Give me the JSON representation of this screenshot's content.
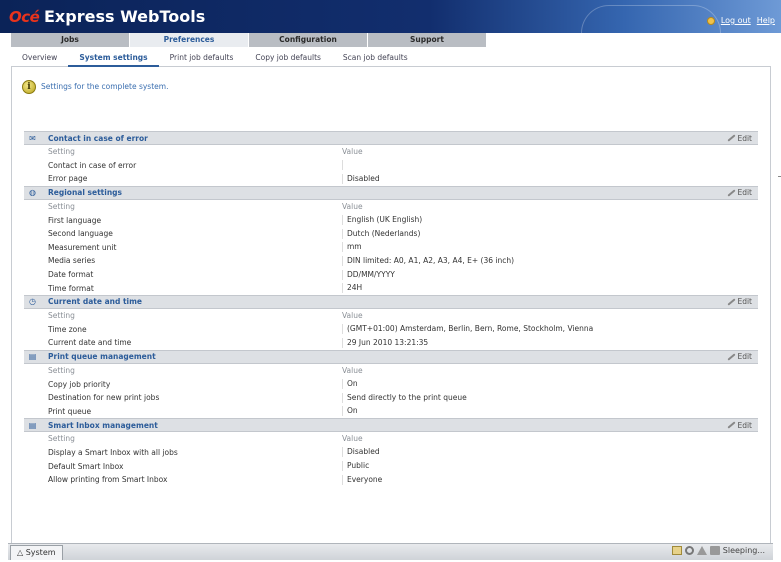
{
  "header": {
    "logo": "Océ",
    "title": "Express WebTools",
    "logout": "Log out",
    "help": "Help"
  },
  "main_tabs": [
    "Jobs",
    "Preferences",
    "Configuration",
    "Support"
  ],
  "subtabs": [
    "Overview",
    "System settings",
    "Print job defaults",
    "Copy job defaults",
    "Scan job defaults"
  ],
  "info": "Settings for the complete system.",
  "edit_label": "Edit",
  "col_setting": "Setting",
  "col_value": "Value",
  "sections": [
    {
      "title": "Contact in case of error",
      "icon": "envelope-icon",
      "rows": [
        {
          "k": "Contact in case of error",
          "v": ""
        },
        {
          "k": "Error page",
          "v": "Disabled"
        }
      ]
    },
    {
      "title": "Regional settings",
      "icon": "globe-icon",
      "rows": [
        {
          "k": "First language",
          "v": "English (UK English)"
        },
        {
          "k": "Second language",
          "v": "Dutch (Nederlands)"
        },
        {
          "k": "Measurement unit",
          "v": "mm"
        },
        {
          "k": "Media series",
          "v": "DIN limited: A0, A1, A2, A3, A4, E+ (36 inch)"
        },
        {
          "k": "Date format",
          "v": "DD/MM/YYYY"
        },
        {
          "k": "Time format",
          "v": "24H"
        }
      ]
    },
    {
      "title": "Current date and time",
      "icon": "clock-icon",
      "rows": [
        {
          "k": "Time zone",
          "v": "(GMT+01:00) Amsterdam, Berlin, Bern, Rome, Stockholm, Vienna"
        },
        {
          "k": "Current date and time",
          "v": "29 Jun 2010 13:21:35"
        }
      ]
    },
    {
      "title": "Print queue management",
      "icon": "document-icon",
      "rows": [
        {
          "k": "Copy job priority",
          "v": "On"
        },
        {
          "k": "Destination for new print jobs",
          "v": "Send directly to the print queue"
        },
        {
          "k": "Print queue",
          "v": "On"
        }
      ]
    },
    {
      "title": "Smart Inbox management",
      "icon": "document-icon",
      "rows": [
        {
          "k": "Display a Smart Inbox with all jobs",
          "v": "Disabled"
        },
        {
          "k": "Default Smart Inbox",
          "v": "Public"
        },
        {
          "k": "Allow printing from Smart Inbox",
          "v": "Everyone"
        }
      ]
    }
  ],
  "statusbar": {
    "system_tab": "System",
    "status": "Sleeping..."
  }
}
